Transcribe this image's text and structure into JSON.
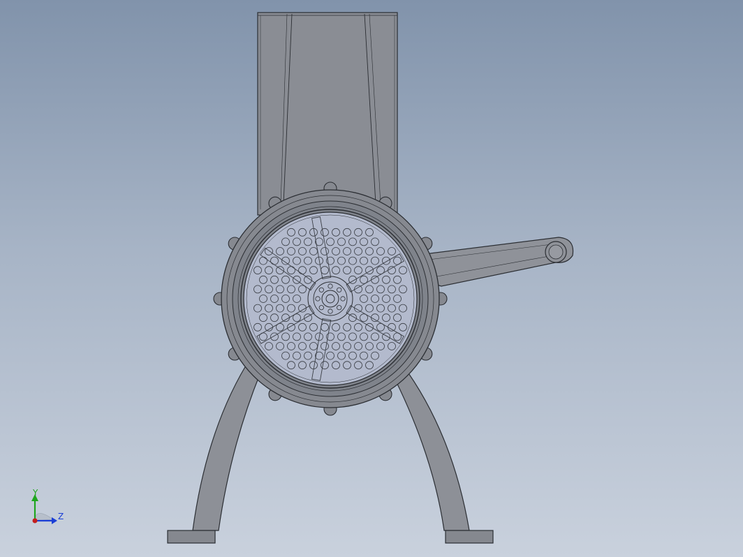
{
  "viewport": {
    "background_top": "#8193ab",
    "background_bottom": "#c9d1dd"
  },
  "model": {
    "description_icon": "meat-grinder-front-view",
    "body_fill": "#8a8d94",
    "edge_color": "#2b2e33",
    "screen_fill": "#b4bbce"
  },
  "triad": {
    "y_label": "Y",
    "z_label": "Z",
    "y_color": "#1ea61e",
    "z_color": "#1b3fd6",
    "x_color": "#c41e1e"
  }
}
